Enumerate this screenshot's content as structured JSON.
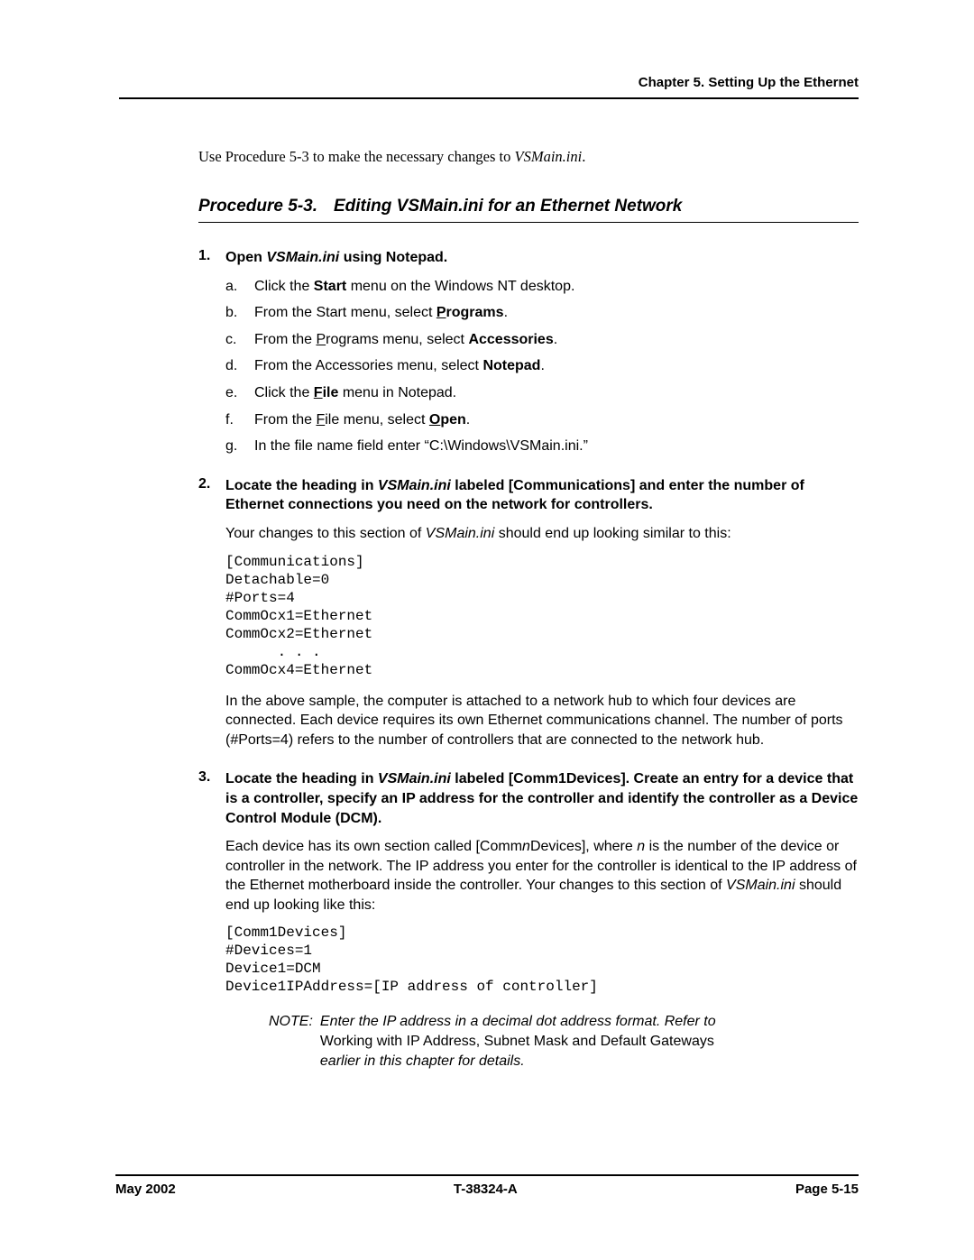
{
  "header": {
    "chapter": "Chapter 5. Setting Up the Ethernet"
  },
  "intro": {
    "prefix": "Use Procedure 5-3 to make the necessary changes to ",
    "file": "VSMain.ini",
    "suffix": "."
  },
  "procedure": {
    "label": "Procedure 5-3.",
    "title": "Editing VSMain.ini for an Ethernet Network"
  },
  "steps": [
    {
      "head_parts": [
        "Open ",
        "VSMain.ini",
        " using Notepad."
      ],
      "sub": [
        {
          "pre": "Click the ",
          "bold": "Start",
          "post": " menu on the Windows NT desktop."
        },
        {
          "pre": "From the Start menu, select ",
          "access": {
            "ul": "P",
            "rest": "rograms"
          },
          "post": "."
        },
        {
          "pre": "From the ",
          "access2": {
            "ul": "P",
            "rest": "rograms"
          },
          "mid": " menu, select ",
          "bold": "Accessories",
          "post": "."
        },
        {
          "pre": "From the Accessories menu, select ",
          "bold": "Notepad",
          "post": "."
        },
        {
          "pre": "Click the ",
          "access": {
            "ul": "F",
            "rest": "ile"
          },
          "post": " menu in Notepad."
        },
        {
          "pre": "From the ",
          "access2": {
            "ul": "F",
            "rest": "ile"
          },
          "mid": " menu, select ",
          "access": {
            "ul": "O",
            "rest": "pen"
          },
          "post": "."
        },
        {
          "pre": "In the file name field enter “C:\\Windows\\VSMain.ini.”"
        }
      ]
    },
    {
      "head_parts": [
        "Locate the heading in ",
        "VSMain.ini",
        " labeled [Communications] and enter the number of Ethernet connections you need on the network for controllers."
      ],
      "body_pre": "Your changes to this section of ",
      "body_file": "VSMain.ini",
      "body_post": " should end up looking similar to this:",
      "code": "[Communications]\nDetachable=0\n#Ports=4\nCommOcx1=Ethernet\nCommOcx2=Ethernet\n      . . .\nCommOcx4=Ethernet",
      "after": "In the above sample, the computer is attached to a network hub to which four devices are connected. Each device requires its own Ethernet communications channel. The number of ports (#Ports=4) refers to the number of controllers that are connected to the network hub."
    },
    {
      "head_parts": [
        "Locate the heading in ",
        "VSMain.ini",
        " labeled [Comm1Devices]. Create an entry for a device that is a controller, specify an IP address for the controller and identify the controller as a Device Control Module (DCM)."
      ],
      "body3_a": "Each device has its own section called [Comm",
      "body3_n": "n",
      "body3_b": "Devices], where ",
      "body3_n2": "n",
      "body3_c": " is the number of the device or controller in the network. The IP address you enter for the controller is identical to the IP address of the Ethernet motherboard inside the controller. Your changes to this section of ",
      "body3_file": "VSMain.ini",
      "body3_d": " should end up looking like this:",
      "code": "[Comm1Devices]\n#Devices=1\nDevice1=DCM\nDevice1IPAddress=[IP address of controller]",
      "note": {
        "label": "NOTE:",
        "line1": "Enter the IP address in a decimal dot address format. Refer to",
        "line2": "Working with IP Address, Subnet Mask and Default Gateways",
        "line3": "earlier in this chapter for details."
      }
    }
  ],
  "footer": {
    "left": "May 2002",
    "center": "T-38324-A",
    "right": "Page 5-15"
  }
}
